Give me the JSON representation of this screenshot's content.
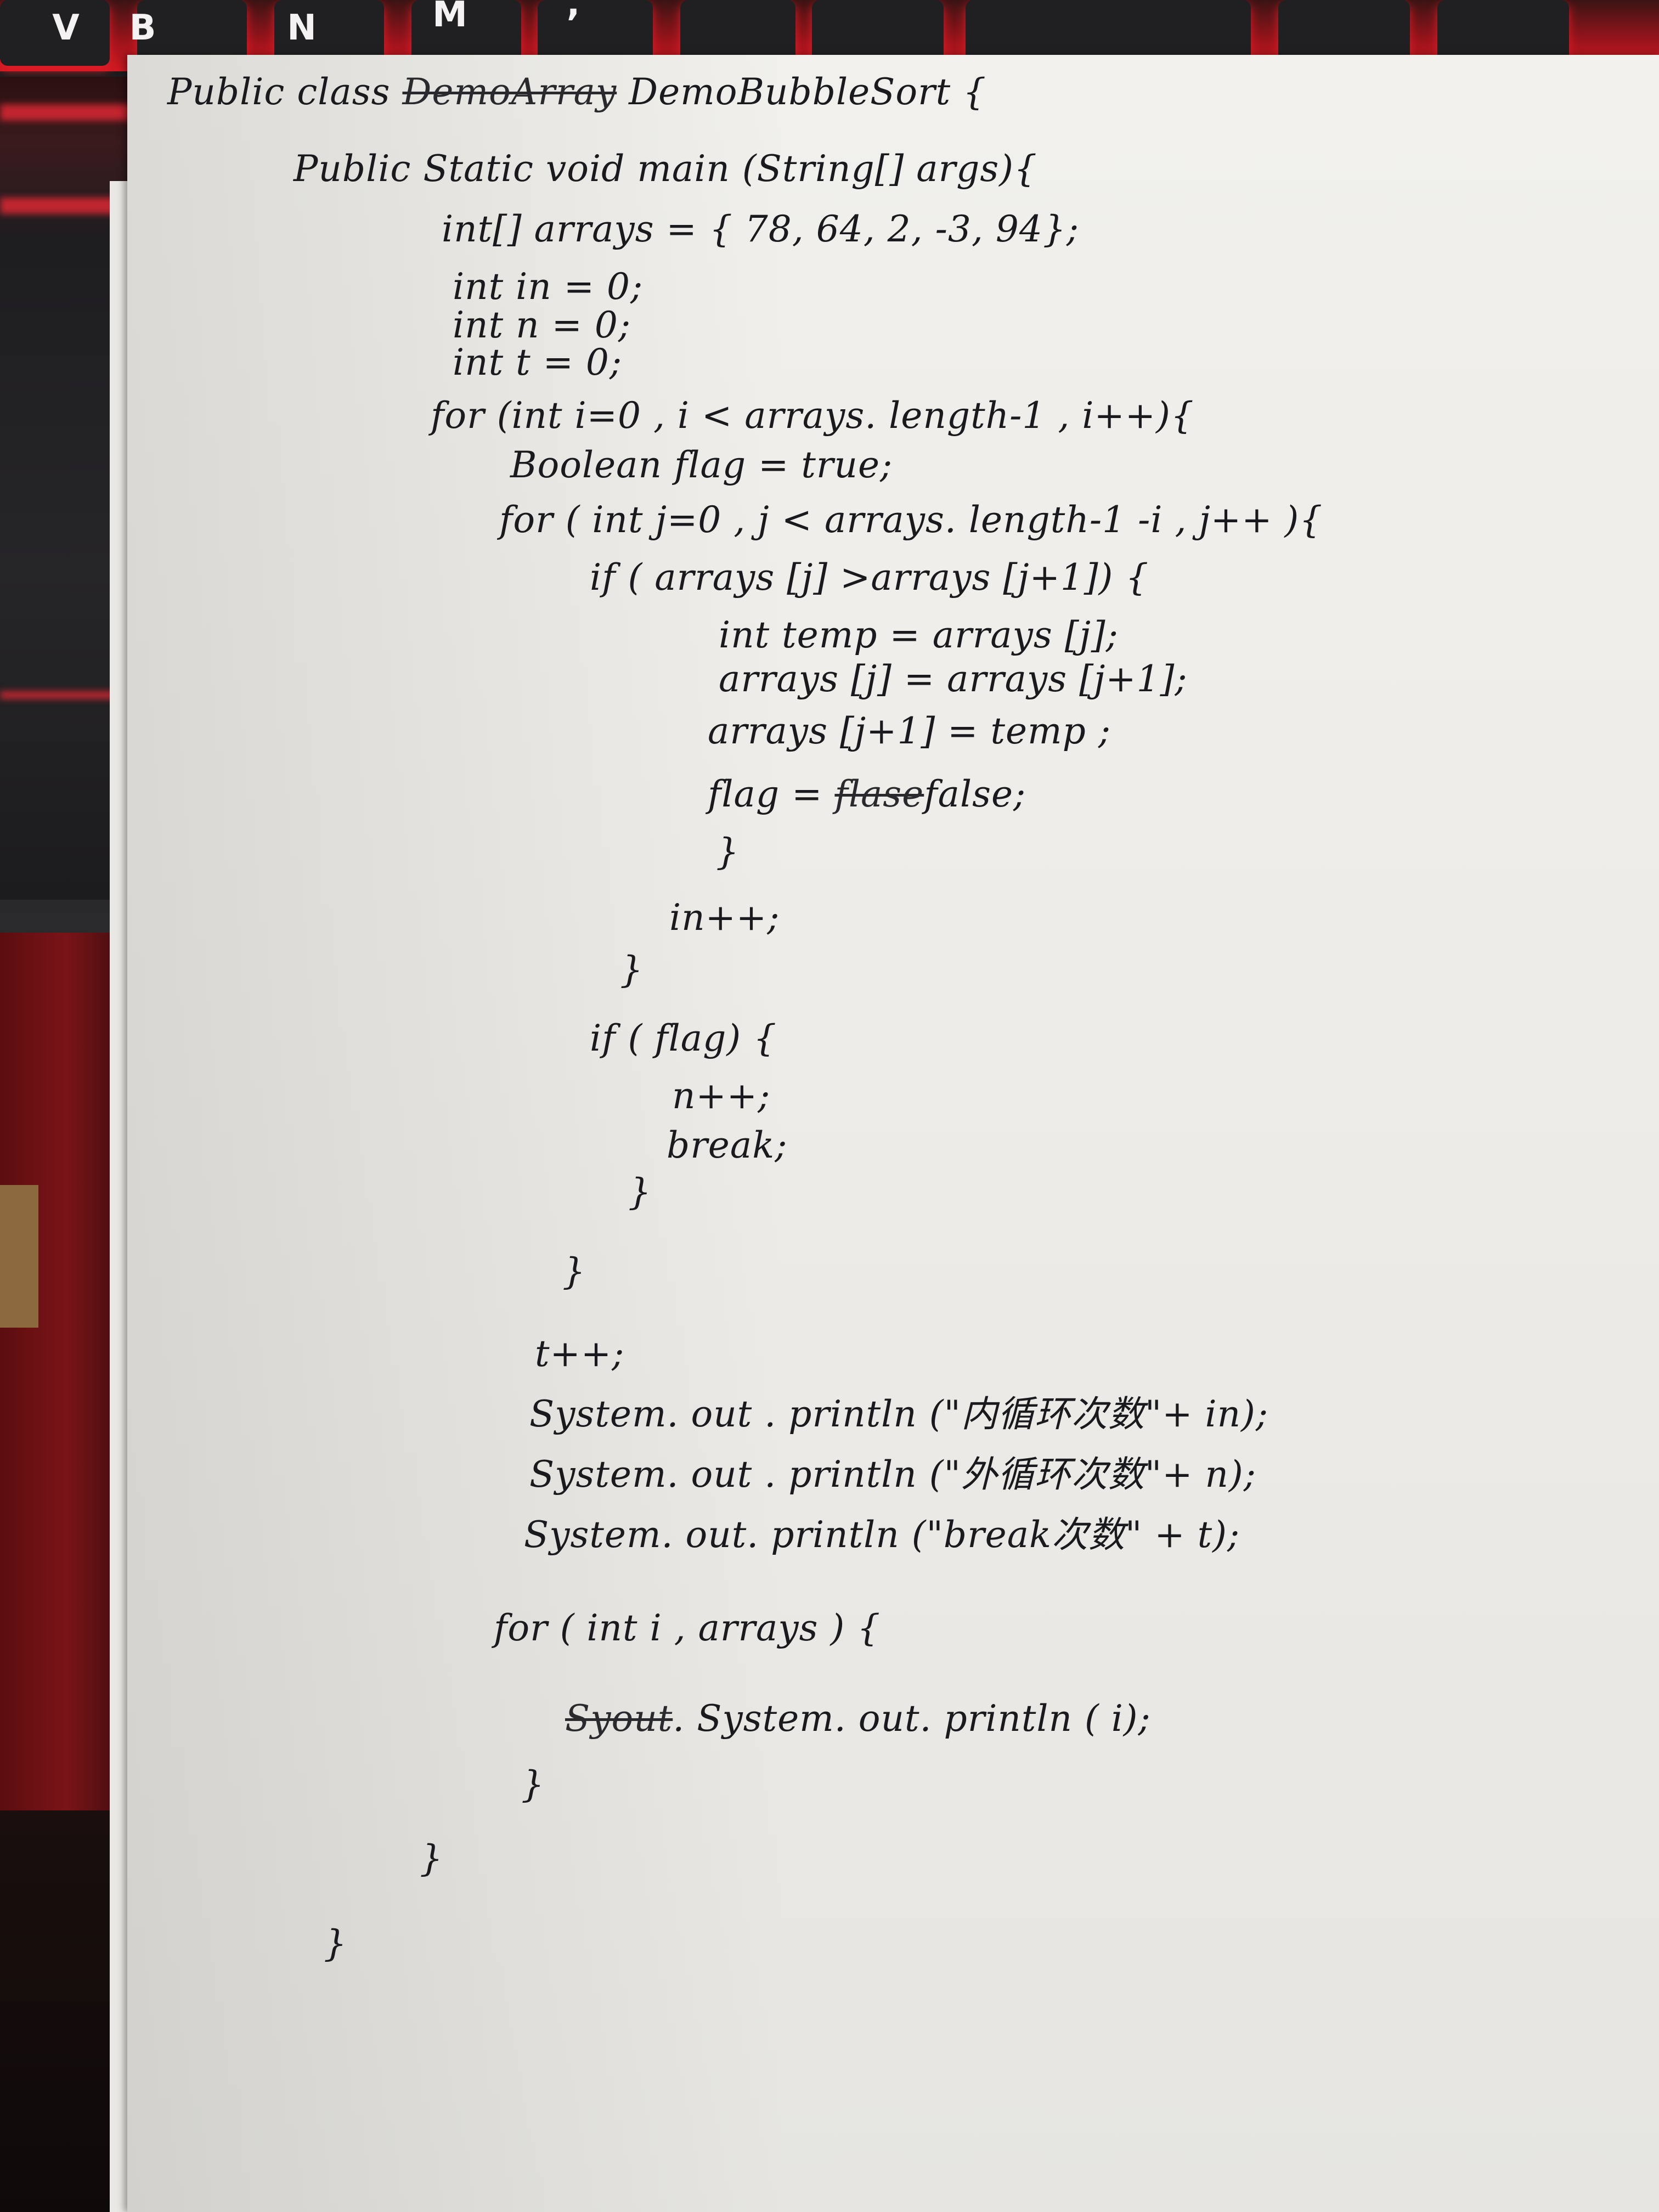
{
  "keyboard": {
    "keys": [
      "V",
      "B",
      "N",
      "M",
      ","
    ]
  },
  "code": {
    "line1_prefix": "Public class",
    "line1_struck": "DemoArray",
    "line1_suffix": "DemoBubbleSort {",
    "line2": "Public Static void main (String[] args){",
    "line3": "int[] arrays = { 78, 64, 2, -3, 94};",
    "line4": "int in = 0;",
    "line5": "int n = 0;",
    "line6": "int t = 0;",
    "line7": "for (int i=0 , i < arrays. length-1 , i++){",
    "line8": "Boolean flag = true;",
    "line9": "for ( int j=0 , j < arrays. length-1 -i , j++ ){",
    "line10": "if ( arrays [j] >arrays [j+1]) {",
    "line11": "int temp = arrays [j];",
    "line12": "arrays [j] = arrays [j+1];",
    "line13": "arrays [j+1] = temp ;",
    "line14_prefix": "flag =",
    "line14_struck": "flase",
    "line14_suffix": "false;",
    "line15": "}",
    "line16": "in++;",
    "line17": "}",
    "line18": "if ( flag) {",
    "line19": "n++;",
    "line20": "break;",
    "line21": "}",
    "line22": "}",
    "line23": "t++;",
    "line24": "System. out . println (\"内循环次数\"+ in);",
    "line25": "System. out . println (\"外循环次数\"+ n);",
    "line26": "System. out. println (\"break次数\" + t);",
    "line27": "for ( int i , arrays ) {",
    "line28_struck": "Syout",
    "line28_suffix": ". System. out. println ( i);",
    "line29": "}",
    "line30": "}",
    "line31": "}"
  }
}
